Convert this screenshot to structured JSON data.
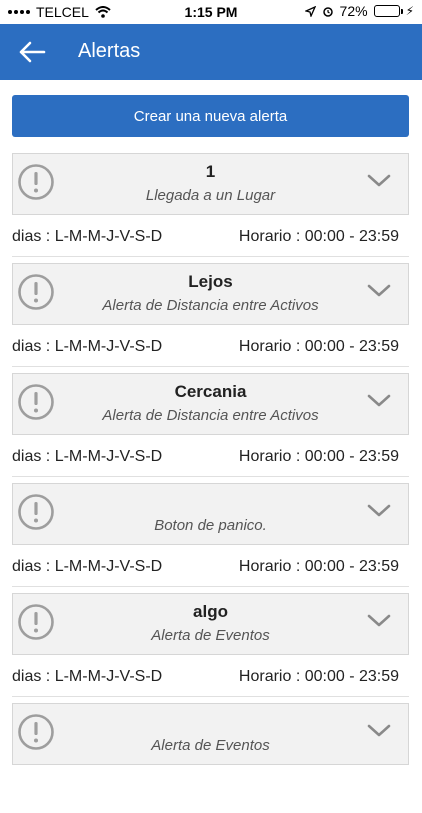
{
  "status_bar": {
    "carrier": "TELCEL",
    "time": "1:15 PM",
    "battery": "72%",
    "battery_level": 0.72
  },
  "header": {
    "title": "Alertas",
    "back_icon": "arrow-left-icon"
  },
  "create_button": {
    "label": "Crear una nueva alerta"
  },
  "colors": {
    "primary": "#2c6ec1",
    "card_bg": "#f2f2f2",
    "icon_gray": "#9e9e9e"
  },
  "alerts": [
    {
      "name": "1",
      "type": "Llegada a un Lugar",
      "days": "dias : L-M-M-J-V-S-D",
      "schedule": "Horario : 00:00 - 23:59"
    },
    {
      "name": "Lejos",
      "type": "Alerta de Distancia entre Activos",
      "days": "dias : L-M-M-J-V-S-D",
      "schedule": "Horario : 00:00 - 23:59"
    },
    {
      "name": "Cercania",
      "type": "Alerta de Distancia entre Activos",
      "days": "dias : L-M-M-J-V-S-D",
      "schedule": "Horario : 00:00 - 23:59"
    },
    {
      "name": "",
      "type": "Boton de panico.",
      "days": "dias : L-M-M-J-V-S-D",
      "schedule": "Horario : 00:00 - 23:59"
    },
    {
      "name": "algo",
      "type": "Alerta de Eventos",
      "days": "dias : L-M-M-J-V-S-D",
      "schedule": "Horario : 00:00 - 23:59"
    },
    {
      "name": "",
      "type": "Alerta de Eventos",
      "days": "",
      "schedule": ""
    }
  ]
}
